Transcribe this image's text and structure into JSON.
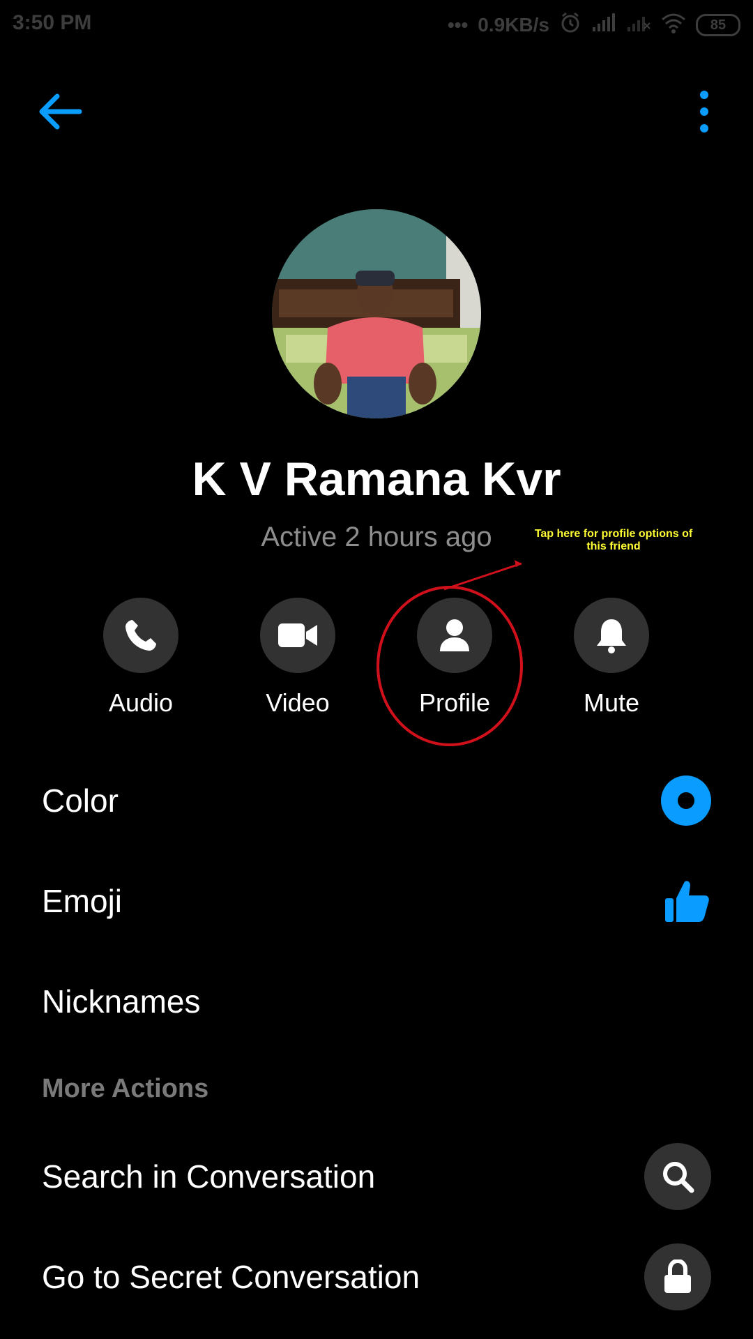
{
  "status_bar": {
    "time": "3:50 PM",
    "dots": "•••",
    "speed": "0.9KB/s",
    "battery": "85"
  },
  "contact": {
    "name": "K V Ramana Kvr",
    "active_status": "Active 2 hours ago"
  },
  "annotation": {
    "text": "Tap here for profile options of this friend",
    "color": "#ffff33",
    "circle_color": "#d0101a"
  },
  "actions": [
    {
      "label": "Audio",
      "icon": "phone-icon"
    },
    {
      "label": "Video",
      "icon": "video-camera-icon"
    },
    {
      "label": "Profile",
      "icon": "person-icon"
    },
    {
      "label": "Mute",
      "icon": "bell-icon"
    }
  ],
  "settings": {
    "color_label": "Color",
    "emoji_label": "Emoji",
    "nicknames_label": "Nicknames",
    "more_actions_header": "More Actions",
    "search_label": "Search in Conversation",
    "secret_label": "Go to Secret Conversation"
  },
  "colors": {
    "accent": "#0a9cff",
    "background": "#000000",
    "button_bg": "#323232",
    "muted_text": "#8e8e8e"
  }
}
